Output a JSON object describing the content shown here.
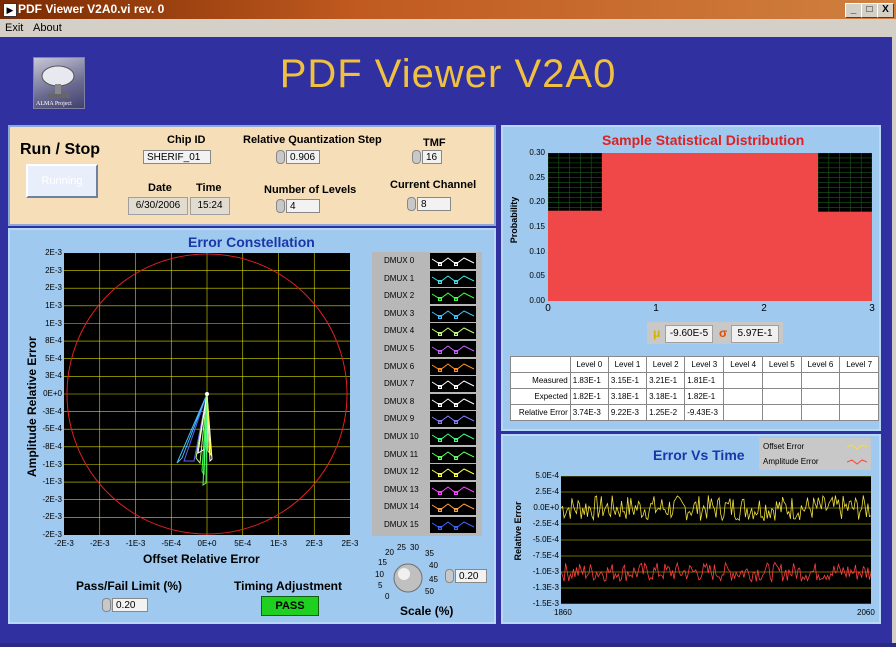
{
  "window": {
    "title": "PDF Viewer V2A0.vi rev. 0",
    "minimize": "_",
    "maximize": "□",
    "close": "X"
  },
  "menu": {
    "exit": "Exit",
    "about": "About"
  },
  "header": {
    "title": "PDF Viewer  V2A0",
    "logo_text": "ALMA Project"
  },
  "controls": {
    "run_stop_label": "Run / Stop",
    "run_button": "Running",
    "chip_id_label": "Chip ID",
    "chip_id": "SHERIF_01",
    "rqs_label": "Relative Quantization Step",
    "rqs_value": "0.906",
    "tmf_label": "TMF",
    "tmf_value": "16",
    "date_label": "Date",
    "date_value": "6/30/2006",
    "time_label": "Time",
    "time_value": "15:24",
    "levels_label": "Number of Levels",
    "levels_value": "4",
    "channel_label": "Current Channel",
    "channel_value": "8"
  },
  "constellation": {
    "title": "Error Constellation",
    "ylabel": "Amplitude Relative Error",
    "xlabel": "Offset Relative Error",
    "yticks": [
      "2E-3",
      "2E-3",
      "2E-3",
      "1E-3",
      "1E-3",
      "8E-4",
      "5E-4",
      "3E-4",
      "0E+0",
      "-3E-4",
      "-5E-4",
      "-8E-4",
      "-1E-3",
      "-1E-3",
      "-2E-3",
      "-2E-3",
      "-2E-3"
    ],
    "xticks": [
      "-2E-3",
      "-2E-3",
      "-1E-3",
      "-5E-4",
      "0E+0",
      "5E-4",
      "1E-3",
      "2E-3",
      "2E-3"
    ],
    "pass_fail_label": "Pass/Fail Limit (%)",
    "pass_fail_value": "0.20",
    "timing_label": "Timing Adjustment",
    "timing_status": "PASS",
    "scale_label": "Scale (%)",
    "scale_value": "0.20",
    "knob_ticks": [
      "0",
      "5",
      "10",
      "15",
      "20",
      "25",
      "30",
      "35",
      "40",
      "45",
      "50"
    ]
  },
  "dmux": {
    "labels": [
      "DMUX 0",
      "DMUX 1",
      "DMUX 2",
      "DMUX 3",
      "DMUX 4",
      "DMUX 5",
      "DMUX 6",
      "DMUX 7",
      "DMUX 8",
      "DMUX 9",
      "DMUX 10",
      "DMUX 11",
      "DMUX 12",
      "DMUX 13",
      "DMUX 14",
      "DMUX 15"
    ],
    "colors": [
      "#ffffff",
      "#40e0e0",
      "#40ff40",
      "#40c0ff",
      "#c0ff80",
      "#c060ff",
      "#ff9020",
      "#ffffff",
      "#ffffff",
      "#8080ff",
      "#40ff80",
      "#60ff60",
      "#ffff40",
      "#ff40ff",
      "#ffa040",
      "#4060ff"
    ]
  },
  "distribution": {
    "title": "Sample Statistical Distribution",
    "ylabel": "Probability",
    "yticks": [
      "0.30",
      "0.25",
      "0.20",
      "0.15",
      "0.10",
      "0.05",
      "0.00"
    ],
    "xticks": [
      "0",
      "1",
      "2",
      "3"
    ],
    "mu_symbol": "μ",
    "mu_value": "-9.60E-5",
    "sigma_symbol": "σ",
    "sigma_value": "5.97E-1"
  },
  "chart_data": [
    {
      "type": "bar",
      "title": "Sample Statistical Distribution",
      "ylabel": "Probability",
      "xlabel": "",
      "ylim": [
        0,
        0.3
      ],
      "xlim": [
        0,
        3
      ],
      "bars": [
        {
          "x0": 0,
          "x1": 0.5,
          "value": 0.183
        },
        {
          "x0": 0.5,
          "x1": 1.5,
          "value": 0.315
        },
        {
          "x0": 1.5,
          "x1": 2.5,
          "value": 0.321
        },
        {
          "x0": 2.5,
          "x1": 3,
          "value": 0.181
        }
      ],
      "grid": true
    },
    {
      "type": "line",
      "title": "Error Vs Time",
      "ylabel": "Relative Error",
      "xlim": [
        1860,
        2060
      ],
      "ylim": [
        -0.0015,
        0.0005
      ],
      "series": [
        {
          "name": "Offset Error",
          "color": "#f0e040",
          "mean": 0.0,
          "amplitude": 0.0002
        },
        {
          "name": "Amplitude Error",
          "color": "#ff4040",
          "mean": -0.001,
          "amplitude": 0.00015
        }
      ],
      "grid": true,
      "legend": "top-right"
    }
  ],
  "stats_table": {
    "headers": [
      "",
      "Level 0",
      "Level 1",
      "Level 2",
      "Level 3",
      "Level 4",
      "Level 5",
      "Level 6",
      "Level 7"
    ],
    "rows": [
      [
        "Measured",
        "1.83E-1",
        "3.15E-1",
        "3.21E-1",
        "1.81E-1",
        "",
        "",
        "",
        ""
      ],
      [
        "Expected",
        "1.82E-1",
        "3.18E-1",
        "3.18E-1",
        "1.82E-1",
        "",
        "",
        "",
        ""
      ],
      [
        "Relative Error",
        "3.74E-3",
        "9.22E-3",
        "1.25E-2",
        "-9.43E-3",
        "",
        "",
        "",
        ""
      ]
    ]
  },
  "error_time": {
    "title": "Error Vs Time",
    "ylabel": "Relative Error",
    "yticks": [
      "5.0E-4",
      "2.5E-4",
      "0.0E+0",
      "-2.5E-4",
      "-5.0E-4",
      "-7.5E-4",
      "-1.0E-3",
      "-1.3E-3",
      "-1.5E-3"
    ],
    "xmin": "1860",
    "xmax": "2060",
    "legend_offset": "Offset Error",
    "legend_amplitude": "Amplitude Error"
  }
}
